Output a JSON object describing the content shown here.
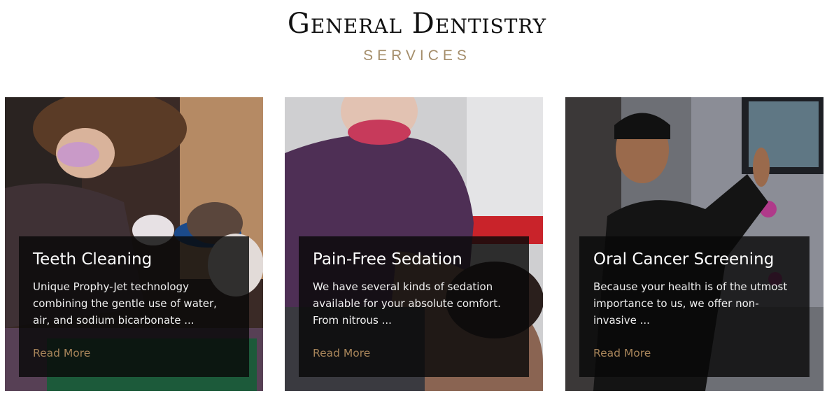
{
  "section": {
    "title": "General Dentistry",
    "subtitle": "SERVICES"
  },
  "cards": [
    {
      "title": "Teeth Cleaning",
      "description": "Unique Prophy-Jet technology combining the gentle use of water, air, and sodium bicarbonate ...",
      "link": "Read More"
    },
    {
      "title": "Pain-Free Sedation",
      "description": "We have several kinds of sedation available for your absolute comfort. From nitrous ...",
      "link": "Read More"
    },
    {
      "title": "Oral Cancer Screening",
      "description": "Because your health is of the utmost importance to us, we offer non-invasive ...",
      "link": "Read More"
    }
  ],
  "colors": {
    "accent": "#a48d6a",
    "link": "#a8855a",
    "overlay": "#080808"
  }
}
